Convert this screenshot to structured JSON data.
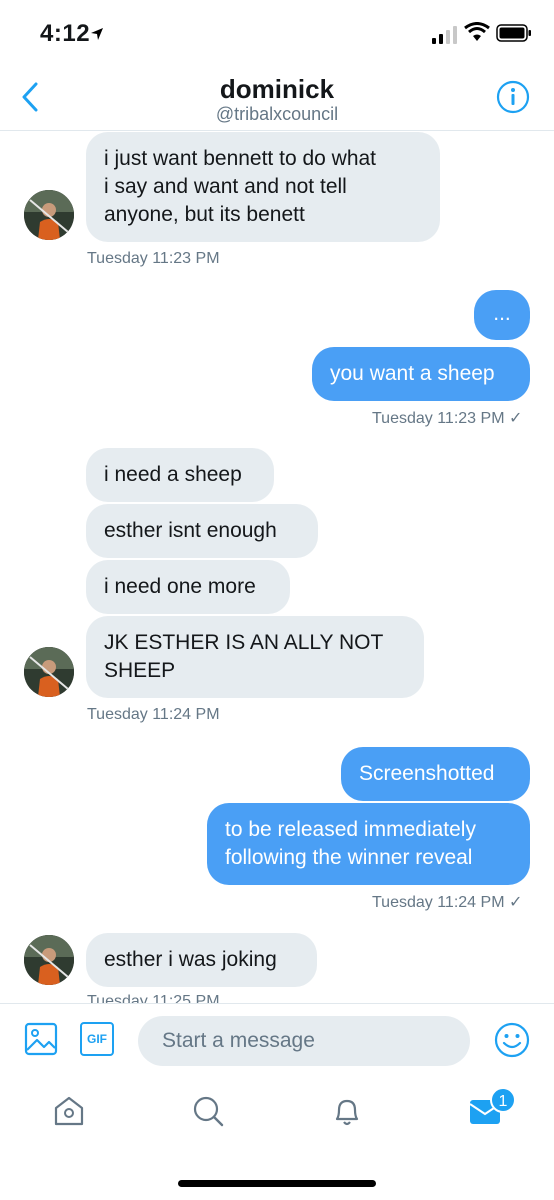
{
  "status_bar": {
    "time": "4:12"
  },
  "header": {
    "name": "dominick",
    "handle": "@tribalxcouncil"
  },
  "messages": {
    "m1": "i just want bennett to do what\ni say and want and not tell\nanyone, but its benett",
    "t1": "Tuesday 11:23 PM",
    "m2": "...",
    "m3": "you want a sheep",
    "t2": "Tuesday 11:23 PM ✓",
    "m4": "i need a sheep",
    "m5": "esther isnt enough",
    "m6": "i need one more",
    "m7": "JK ESTHER IS AN ALLY NOT\nSHEEP",
    "t3": "Tuesday 11:24 PM",
    "m8": "Screenshotted",
    "m9": "to be released immediately\nfollowing the winner reveal",
    "t4": "Tuesday 11:24 PM ✓",
    "m10": "esther i was joking",
    "t5": "Tuesday 11:25 PM"
  },
  "composer": {
    "placeholder": "Start a message",
    "gif_label": "GIF"
  },
  "tabbar": {
    "messages_badge": "1"
  },
  "colors": {
    "accent": "#1da1f2",
    "outgoing_bubble": "#4a9ff5",
    "incoming_bubble": "#e6ecf0"
  }
}
